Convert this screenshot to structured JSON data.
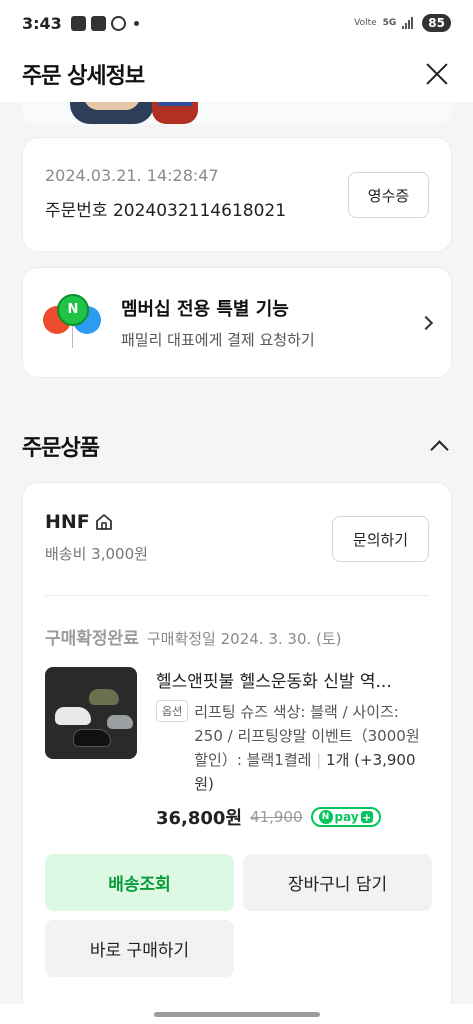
{
  "status_bar": {
    "time": "3:43",
    "network": "5G",
    "carrier": "Volte",
    "battery": "85"
  },
  "header": {
    "title": "주문 상세정보"
  },
  "order": {
    "date": "2024.03.21. 14:28:47",
    "number_label": "주문번호",
    "number": "2024032114618021",
    "receipt_button": "영수증"
  },
  "membership": {
    "badge_letter": "N",
    "title": "멤버십 전용 특별 기능",
    "subtitle": "패밀리 대표에게 결제 요청하기"
  },
  "section": {
    "title": "주문상품"
  },
  "seller": {
    "name": "HNF",
    "shipping_fee": "배송비 3,000원",
    "inquiry_button": "문의하기"
  },
  "product": {
    "status": "구매확정완료",
    "confirm_date": "구매확정일 2024. 3. 30. (토)",
    "name": "헬스앤핏불 헬스운동화 신발 역...",
    "option_badge": "옵션",
    "option_text": "리프팅 슈즈 색상: 블랙 / 사이즈: 250 / 리프팅양말 이벤트（3000원 할인）: 블랙1켤레",
    "option_sep": "|",
    "quantity": "1개 (+3,900원)",
    "price": "36,800원",
    "original_price": "41,900",
    "npay_badge_n": "N",
    "npay_badge": "pay"
  },
  "actions": {
    "track_delivery": "배송조회",
    "add_to_cart": "장바구니 담기",
    "buy_now": "바로 구매하기"
  }
}
